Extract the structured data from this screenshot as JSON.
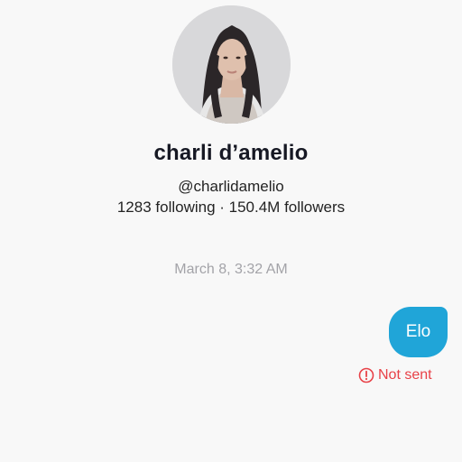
{
  "profile": {
    "avatar_icon": "profile-photo",
    "display_name": "charli d’amelio",
    "handle": "@charlidamelio",
    "stats": "1283 following · 150.4M followers"
  },
  "chat": {
    "timestamp": "March 8, 3:32 AM",
    "messages": [
      {
        "text": "Elo",
        "status": "Not sent",
        "status_icon": "exclamation-circle-icon"
      }
    ]
  },
  "colors": {
    "background": "#f8f8f8",
    "bubble": "#20a5d8",
    "error": "#e84147",
    "muted_text": "#a3a3a8"
  }
}
